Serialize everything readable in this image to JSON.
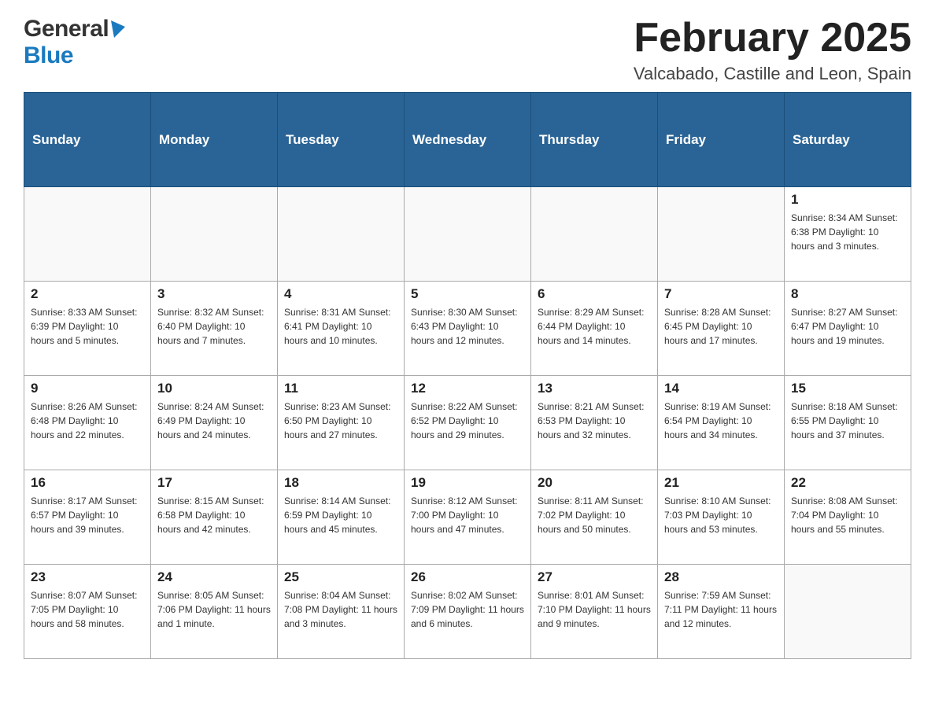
{
  "logo": {
    "general": "General",
    "blue": "Blue"
  },
  "header": {
    "title": "February 2025",
    "subtitle": "Valcabado, Castille and Leon, Spain"
  },
  "weekdays": [
    "Sunday",
    "Monday",
    "Tuesday",
    "Wednesday",
    "Thursday",
    "Friday",
    "Saturday"
  ],
  "weeks": [
    [
      {
        "day": "",
        "info": ""
      },
      {
        "day": "",
        "info": ""
      },
      {
        "day": "",
        "info": ""
      },
      {
        "day": "",
        "info": ""
      },
      {
        "day": "",
        "info": ""
      },
      {
        "day": "",
        "info": ""
      },
      {
        "day": "1",
        "info": "Sunrise: 8:34 AM\nSunset: 6:38 PM\nDaylight: 10 hours and 3 minutes."
      }
    ],
    [
      {
        "day": "2",
        "info": "Sunrise: 8:33 AM\nSunset: 6:39 PM\nDaylight: 10 hours and 5 minutes."
      },
      {
        "day": "3",
        "info": "Sunrise: 8:32 AM\nSunset: 6:40 PM\nDaylight: 10 hours and 7 minutes."
      },
      {
        "day": "4",
        "info": "Sunrise: 8:31 AM\nSunset: 6:41 PM\nDaylight: 10 hours and 10 minutes."
      },
      {
        "day": "5",
        "info": "Sunrise: 8:30 AM\nSunset: 6:43 PM\nDaylight: 10 hours and 12 minutes."
      },
      {
        "day": "6",
        "info": "Sunrise: 8:29 AM\nSunset: 6:44 PM\nDaylight: 10 hours and 14 minutes."
      },
      {
        "day": "7",
        "info": "Sunrise: 8:28 AM\nSunset: 6:45 PM\nDaylight: 10 hours and 17 minutes."
      },
      {
        "day": "8",
        "info": "Sunrise: 8:27 AM\nSunset: 6:47 PM\nDaylight: 10 hours and 19 minutes."
      }
    ],
    [
      {
        "day": "9",
        "info": "Sunrise: 8:26 AM\nSunset: 6:48 PM\nDaylight: 10 hours and 22 minutes."
      },
      {
        "day": "10",
        "info": "Sunrise: 8:24 AM\nSunset: 6:49 PM\nDaylight: 10 hours and 24 minutes."
      },
      {
        "day": "11",
        "info": "Sunrise: 8:23 AM\nSunset: 6:50 PM\nDaylight: 10 hours and 27 minutes."
      },
      {
        "day": "12",
        "info": "Sunrise: 8:22 AM\nSunset: 6:52 PM\nDaylight: 10 hours and 29 minutes."
      },
      {
        "day": "13",
        "info": "Sunrise: 8:21 AM\nSunset: 6:53 PM\nDaylight: 10 hours and 32 minutes."
      },
      {
        "day": "14",
        "info": "Sunrise: 8:19 AM\nSunset: 6:54 PM\nDaylight: 10 hours and 34 minutes."
      },
      {
        "day": "15",
        "info": "Sunrise: 8:18 AM\nSunset: 6:55 PM\nDaylight: 10 hours and 37 minutes."
      }
    ],
    [
      {
        "day": "16",
        "info": "Sunrise: 8:17 AM\nSunset: 6:57 PM\nDaylight: 10 hours and 39 minutes."
      },
      {
        "day": "17",
        "info": "Sunrise: 8:15 AM\nSunset: 6:58 PM\nDaylight: 10 hours and 42 minutes."
      },
      {
        "day": "18",
        "info": "Sunrise: 8:14 AM\nSunset: 6:59 PM\nDaylight: 10 hours and 45 minutes."
      },
      {
        "day": "19",
        "info": "Sunrise: 8:12 AM\nSunset: 7:00 PM\nDaylight: 10 hours and 47 minutes."
      },
      {
        "day": "20",
        "info": "Sunrise: 8:11 AM\nSunset: 7:02 PM\nDaylight: 10 hours and 50 minutes."
      },
      {
        "day": "21",
        "info": "Sunrise: 8:10 AM\nSunset: 7:03 PM\nDaylight: 10 hours and 53 minutes."
      },
      {
        "day": "22",
        "info": "Sunrise: 8:08 AM\nSunset: 7:04 PM\nDaylight: 10 hours and 55 minutes."
      }
    ],
    [
      {
        "day": "23",
        "info": "Sunrise: 8:07 AM\nSunset: 7:05 PM\nDaylight: 10 hours and 58 minutes."
      },
      {
        "day": "24",
        "info": "Sunrise: 8:05 AM\nSunset: 7:06 PM\nDaylight: 11 hours and 1 minute."
      },
      {
        "day": "25",
        "info": "Sunrise: 8:04 AM\nSunset: 7:08 PM\nDaylight: 11 hours and 3 minutes."
      },
      {
        "day": "26",
        "info": "Sunrise: 8:02 AM\nSunset: 7:09 PM\nDaylight: 11 hours and 6 minutes."
      },
      {
        "day": "27",
        "info": "Sunrise: 8:01 AM\nSunset: 7:10 PM\nDaylight: 11 hours and 9 minutes."
      },
      {
        "day": "28",
        "info": "Sunrise: 7:59 AM\nSunset: 7:11 PM\nDaylight: 11 hours and 12 minutes."
      },
      {
        "day": "",
        "info": ""
      }
    ]
  ]
}
